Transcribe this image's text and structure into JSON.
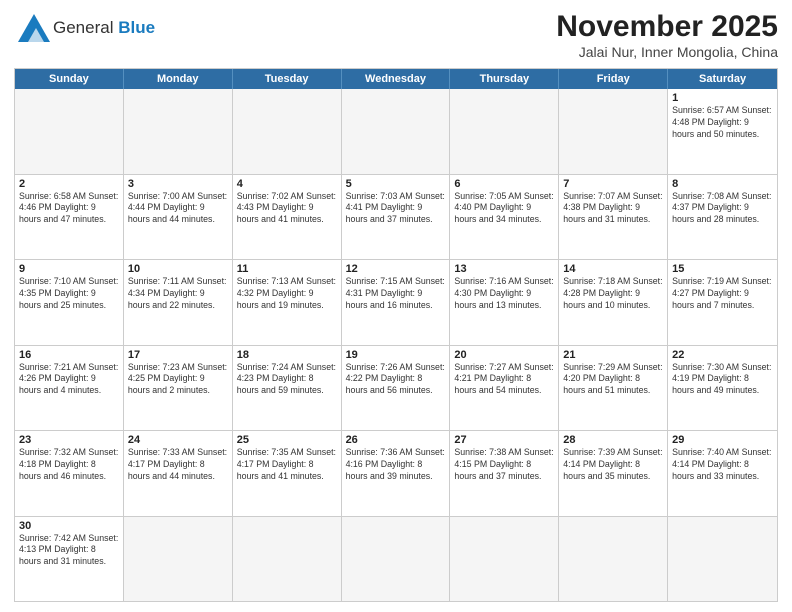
{
  "header": {
    "logo_line1": "General",
    "logo_line2": "Blue",
    "month": "November 2025",
    "location": "Jalai Nur, Inner Mongolia, China"
  },
  "days_of_week": [
    "Sunday",
    "Monday",
    "Tuesday",
    "Wednesday",
    "Thursday",
    "Friday",
    "Saturday"
  ],
  "weeks": [
    [
      {
        "day": "",
        "info": ""
      },
      {
        "day": "",
        "info": ""
      },
      {
        "day": "",
        "info": ""
      },
      {
        "day": "",
        "info": ""
      },
      {
        "day": "",
        "info": ""
      },
      {
        "day": "",
        "info": ""
      },
      {
        "day": "1",
        "info": "Sunrise: 6:57 AM\nSunset: 4:48 PM\nDaylight: 9 hours\nand 50 minutes."
      }
    ],
    [
      {
        "day": "2",
        "info": "Sunrise: 6:58 AM\nSunset: 4:46 PM\nDaylight: 9 hours\nand 47 minutes."
      },
      {
        "day": "3",
        "info": "Sunrise: 7:00 AM\nSunset: 4:44 PM\nDaylight: 9 hours\nand 44 minutes."
      },
      {
        "day": "4",
        "info": "Sunrise: 7:02 AM\nSunset: 4:43 PM\nDaylight: 9 hours\nand 41 minutes."
      },
      {
        "day": "5",
        "info": "Sunrise: 7:03 AM\nSunset: 4:41 PM\nDaylight: 9 hours\nand 37 minutes."
      },
      {
        "day": "6",
        "info": "Sunrise: 7:05 AM\nSunset: 4:40 PM\nDaylight: 9 hours\nand 34 minutes."
      },
      {
        "day": "7",
        "info": "Sunrise: 7:07 AM\nSunset: 4:38 PM\nDaylight: 9 hours\nand 31 minutes."
      },
      {
        "day": "8",
        "info": "Sunrise: 7:08 AM\nSunset: 4:37 PM\nDaylight: 9 hours\nand 28 minutes."
      }
    ],
    [
      {
        "day": "9",
        "info": "Sunrise: 7:10 AM\nSunset: 4:35 PM\nDaylight: 9 hours\nand 25 minutes."
      },
      {
        "day": "10",
        "info": "Sunrise: 7:11 AM\nSunset: 4:34 PM\nDaylight: 9 hours\nand 22 minutes."
      },
      {
        "day": "11",
        "info": "Sunrise: 7:13 AM\nSunset: 4:32 PM\nDaylight: 9 hours\nand 19 minutes."
      },
      {
        "day": "12",
        "info": "Sunrise: 7:15 AM\nSunset: 4:31 PM\nDaylight: 9 hours\nand 16 minutes."
      },
      {
        "day": "13",
        "info": "Sunrise: 7:16 AM\nSunset: 4:30 PM\nDaylight: 9 hours\nand 13 minutes."
      },
      {
        "day": "14",
        "info": "Sunrise: 7:18 AM\nSunset: 4:28 PM\nDaylight: 9 hours\nand 10 minutes."
      },
      {
        "day": "15",
        "info": "Sunrise: 7:19 AM\nSunset: 4:27 PM\nDaylight: 9 hours\nand 7 minutes."
      }
    ],
    [
      {
        "day": "16",
        "info": "Sunrise: 7:21 AM\nSunset: 4:26 PM\nDaylight: 9 hours\nand 4 minutes."
      },
      {
        "day": "17",
        "info": "Sunrise: 7:23 AM\nSunset: 4:25 PM\nDaylight: 9 hours\nand 2 minutes."
      },
      {
        "day": "18",
        "info": "Sunrise: 7:24 AM\nSunset: 4:23 PM\nDaylight: 8 hours\nand 59 minutes."
      },
      {
        "day": "19",
        "info": "Sunrise: 7:26 AM\nSunset: 4:22 PM\nDaylight: 8 hours\nand 56 minutes."
      },
      {
        "day": "20",
        "info": "Sunrise: 7:27 AM\nSunset: 4:21 PM\nDaylight: 8 hours\nand 54 minutes."
      },
      {
        "day": "21",
        "info": "Sunrise: 7:29 AM\nSunset: 4:20 PM\nDaylight: 8 hours\nand 51 minutes."
      },
      {
        "day": "22",
        "info": "Sunrise: 7:30 AM\nSunset: 4:19 PM\nDaylight: 8 hours\nand 49 minutes."
      }
    ],
    [
      {
        "day": "23",
        "info": "Sunrise: 7:32 AM\nSunset: 4:18 PM\nDaylight: 8 hours\nand 46 minutes."
      },
      {
        "day": "24",
        "info": "Sunrise: 7:33 AM\nSunset: 4:17 PM\nDaylight: 8 hours\nand 44 minutes."
      },
      {
        "day": "25",
        "info": "Sunrise: 7:35 AM\nSunset: 4:17 PM\nDaylight: 8 hours\nand 41 minutes."
      },
      {
        "day": "26",
        "info": "Sunrise: 7:36 AM\nSunset: 4:16 PM\nDaylight: 8 hours\nand 39 minutes."
      },
      {
        "day": "27",
        "info": "Sunrise: 7:38 AM\nSunset: 4:15 PM\nDaylight: 8 hours\nand 37 minutes."
      },
      {
        "day": "28",
        "info": "Sunrise: 7:39 AM\nSunset: 4:14 PM\nDaylight: 8 hours\nand 35 minutes."
      },
      {
        "day": "29",
        "info": "Sunrise: 7:40 AM\nSunset: 4:14 PM\nDaylight: 8 hours\nand 33 minutes."
      }
    ],
    [
      {
        "day": "30",
        "info": "Sunrise: 7:42 AM\nSunset: 4:13 PM\nDaylight: 8 hours\nand 31 minutes."
      },
      {
        "day": "",
        "info": ""
      },
      {
        "day": "",
        "info": ""
      },
      {
        "day": "",
        "info": ""
      },
      {
        "day": "",
        "info": ""
      },
      {
        "day": "",
        "info": ""
      },
      {
        "day": "",
        "info": ""
      }
    ]
  ]
}
